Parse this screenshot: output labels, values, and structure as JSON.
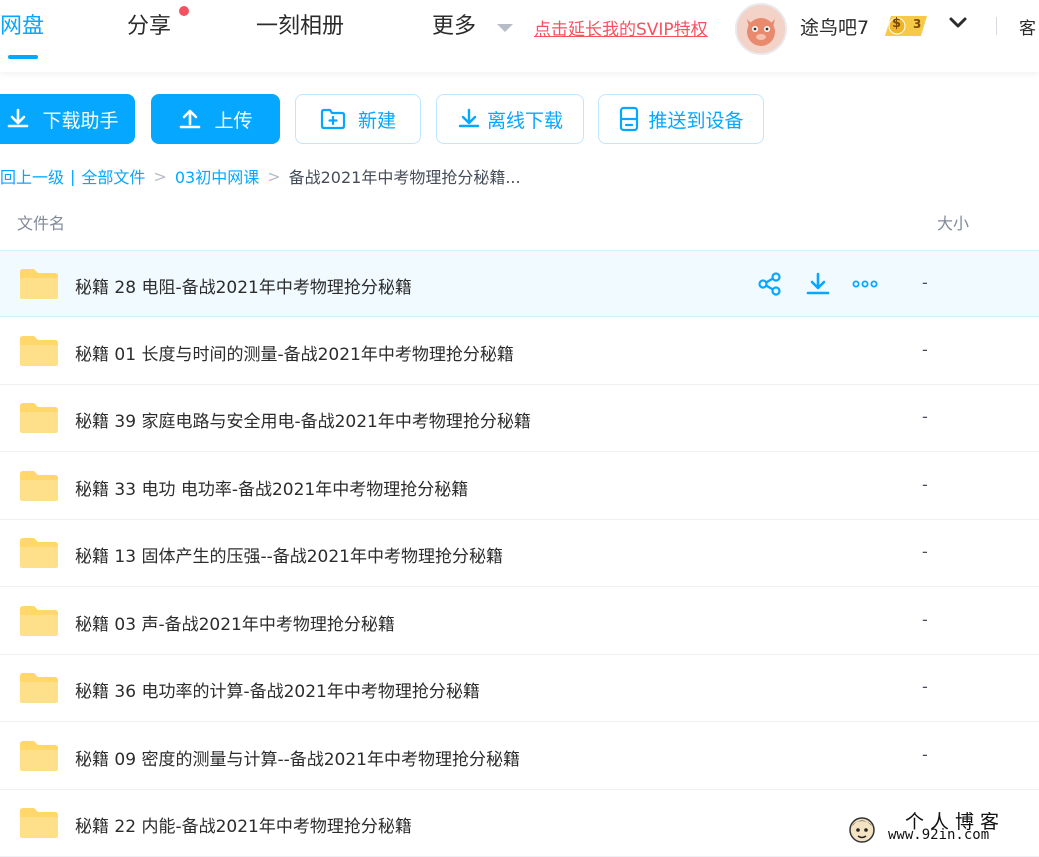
{
  "nav": {
    "tabs": [
      {
        "label": "网盘",
        "active": true
      },
      {
        "label": "分享",
        "has_notification_dot": true
      },
      {
        "label": "一刻相册"
      },
      {
        "label": "更多",
        "has_dropdown": true
      }
    ],
    "promo_link": "点击延长我的SVIP特权",
    "username": "途鸟吧7",
    "vip_badge": {
      "symbol": "$",
      "level": "3"
    },
    "client_label": "客"
  },
  "toolbar": {
    "download_helper": "下载助手",
    "upload": "上传",
    "new_folder": "新建",
    "offline_download": "离线下载",
    "push_to_device": "推送到设备"
  },
  "breadcrumb": {
    "back": "回上一级",
    "all_files": "全部文件",
    "level1": "03初中网课",
    "current": "备战2021年中考物理抢分秘籍..."
  },
  "table": {
    "headers": {
      "name": "文件名",
      "size": "大小"
    },
    "rows": [
      {
        "name": "秘籍 28 电阻-备战2021年中考物理抢分秘籍",
        "size": "-",
        "selected": true
      },
      {
        "name": "秘籍 01 长度与时间的测量-备战2021年中考物理抢分秘籍",
        "size": "-"
      },
      {
        "name": "秘籍 39 家庭电路与安全用电-备战2021年中考物理抢分秘籍",
        "size": "-"
      },
      {
        "name": "秘籍 33 电功 电功率-备战2021年中考物理抢分秘籍",
        "size": "-"
      },
      {
        "name": "秘籍 13 固体产生的压强--备战2021年中考物理抢分秘籍",
        "size": "-"
      },
      {
        "name": "秘籍 03 声-备战2021年中考物理抢分秘籍",
        "size": "-"
      },
      {
        "name": "秘籍 36 电功率的计算-备战2021年中考物理抢分秘籍",
        "size": "-"
      },
      {
        "name": "秘籍 09 密度的测量与计算--备战2021年中考物理抢分秘籍",
        "size": "-"
      },
      {
        "name": "秘籍 22 内能-备战2021年中考物理抢分秘籍",
        "size": "-"
      }
    ]
  },
  "row_actions": [
    "share-icon",
    "download-icon",
    "more-icon"
  ],
  "watermark": {
    "title": "个人博客",
    "url": "www.92in.com"
  },
  "colors": {
    "accent": "#06a7ff",
    "promo": "#f5515f",
    "folder": "#ffd76a",
    "selected_row": "#f0faff"
  }
}
